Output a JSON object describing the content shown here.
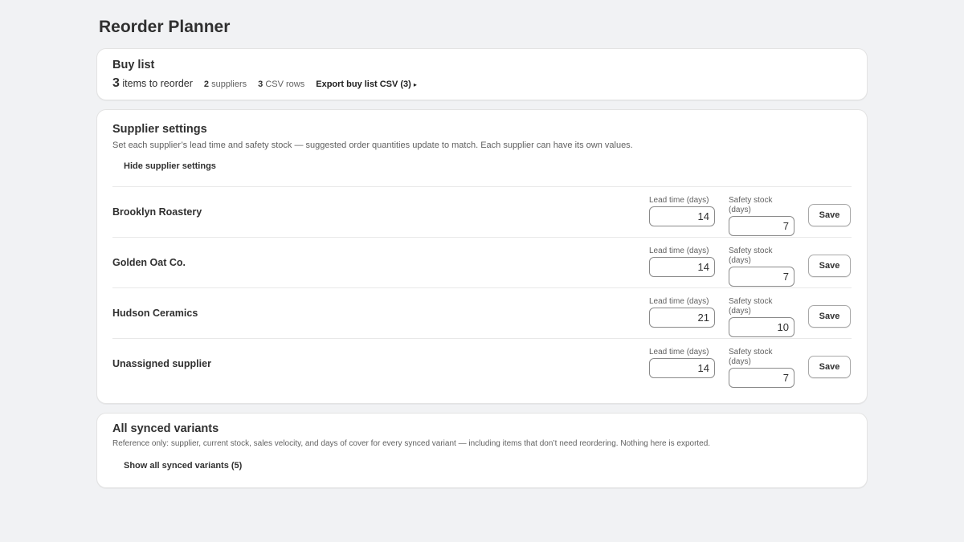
{
  "page": {
    "title": "Reorder Planner"
  },
  "buy_list": {
    "title": "Buy list",
    "items_count": "3",
    "items_label": "items to reorder",
    "suppliers_count": "2",
    "suppliers_label": "suppliers",
    "csv_count": "3",
    "csv_label": "CSV rows",
    "export_label": "Export buy list CSV (3)",
    "export_caret": "▸"
  },
  "supplier_settings": {
    "title": "Supplier settings",
    "description": "Set each supplier’s lead time and safety stock — suggested order quantities update to match. Each supplier can have its own values.",
    "toggle_label": "Hide supplier settings",
    "lead_label": "Lead time (days)",
    "safety_label": "Safety stock (days)",
    "save_label": "Save",
    "suppliers": [
      {
        "name": "Brooklyn Roastery",
        "lead": "14",
        "safety": "7"
      },
      {
        "name": "Golden Oat Co.",
        "lead": "14",
        "safety": "7"
      },
      {
        "name": "Hudson Ceramics",
        "lead": "21",
        "safety": "10"
      },
      {
        "name": "Unassigned supplier",
        "lead": "14",
        "safety": "7"
      }
    ]
  },
  "variants": {
    "title": "All synced variants",
    "description": "Reference only: supplier, current stock, sales velocity, and days of cover for every synced variant — including items that don’t need reordering. Nothing here is exported.",
    "toggle_label": "Show all synced variants (5)"
  }
}
